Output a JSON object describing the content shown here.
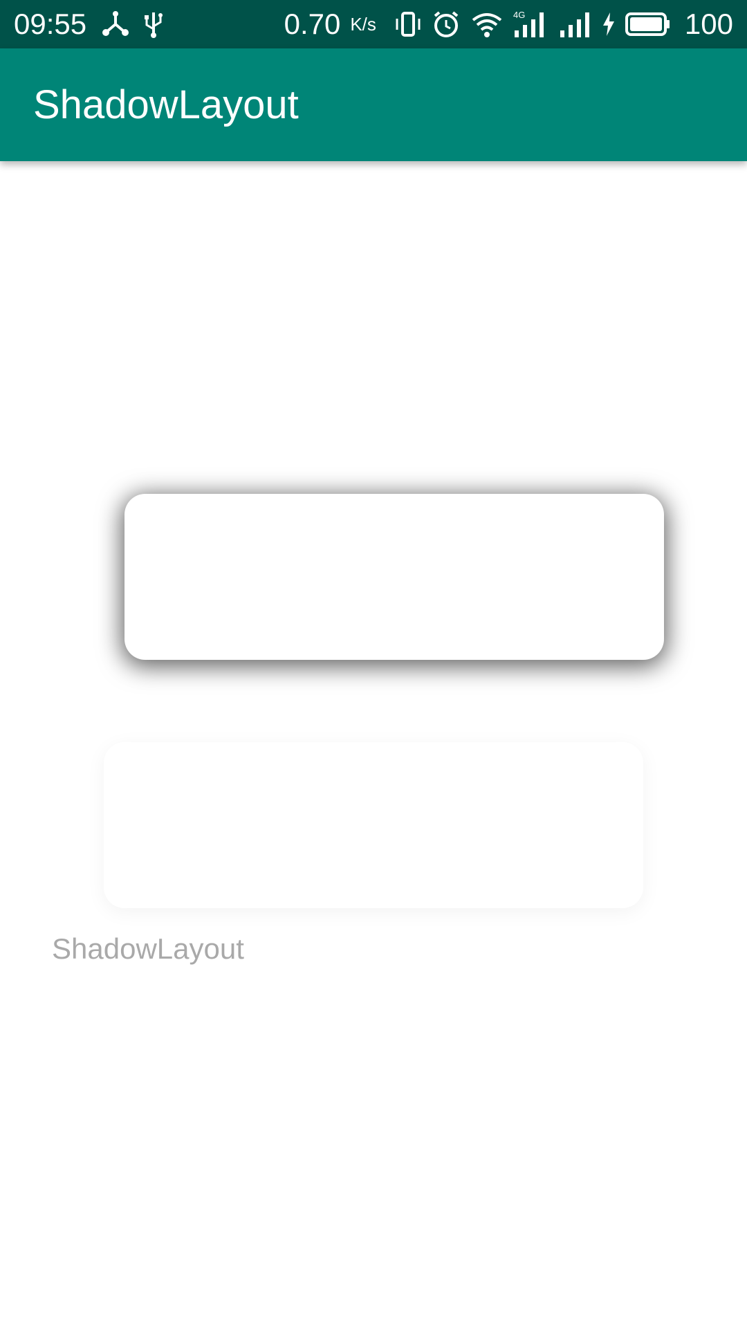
{
  "status_bar": {
    "time": "09:55",
    "network_speed": "0.70",
    "speed_unit": "K/s",
    "network_type": "4G",
    "battery_level": "100",
    "icons": [
      "share-network-icon",
      "usb-icon",
      "vibrate-icon",
      "alarm-icon",
      "wifi-icon",
      "signal-4g-icon",
      "signal-icon",
      "charging-icon",
      "battery-icon"
    ]
  },
  "app_bar": {
    "title": "ShadowLayout",
    "color": "#008577"
  },
  "content": {
    "caption": "ShadowLayout"
  },
  "colors": {
    "status_bar": "#005249",
    "app_bar": "#008577",
    "background": "#ffffff",
    "caption_text": "#a9a9a9"
  }
}
